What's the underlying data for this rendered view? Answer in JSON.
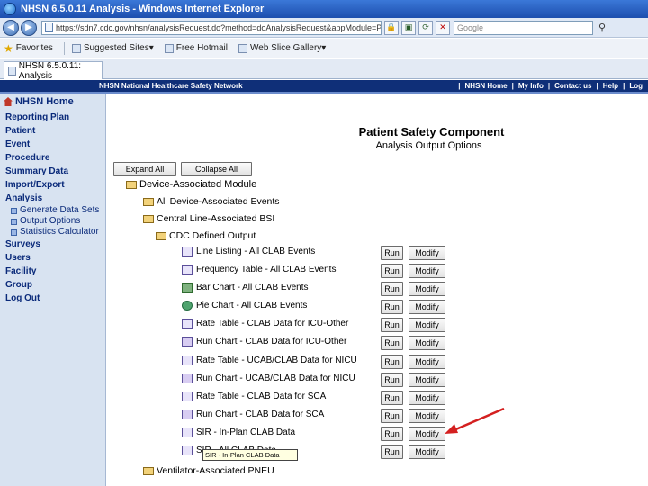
{
  "browser": {
    "window_title": "NHSN 6.5.0.11 Analysis - Windows Internet Explorer",
    "address_url": "https://sdn7.cdc.gov/nhsn/analysisRequest.do?method=doAnalysisRequest&appModule=PS&newF",
    "search_placeholder": "Google",
    "favorites": [
      {
        "label": "Favorites",
        "icon": "favorites-star-icon"
      },
      {
        "label": "Suggested Sites",
        "icon": "page-icon"
      },
      {
        "label": "Free Hotmail",
        "icon": "page-icon"
      },
      {
        "label": "Web Slice Gallery",
        "icon": "page-icon"
      }
    ],
    "tab_label": "NHSN 6.5.0.11: Analysis"
  },
  "nhsn_header": {
    "left": "NHSN   National Healthcare Safety Network",
    "links": [
      "NHSN Home",
      "My Info",
      "Contact us",
      "Help",
      "Log"
    ]
  },
  "sidebar": {
    "home": "NHSN Home",
    "items": [
      {
        "label": "Reporting Plan"
      },
      {
        "label": "Patient"
      },
      {
        "label": "Event"
      },
      {
        "label": "Procedure"
      },
      {
        "label": "Summary Data"
      },
      {
        "label": "Import/Export"
      },
      {
        "label": "Analysis"
      }
    ],
    "subitems": [
      {
        "label": "Generate Data Sets"
      },
      {
        "label": "Output Options"
      },
      {
        "label": "Statistics Calculator"
      }
    ],
    "items_after": [
      {
        "label": "Surveys"
      },
      {
        "label": "Users"
      },
      {
        "label": "Facility"
      },
      {
        "label": "Group"
      },
      {
        "label": "Log Out"
      }
    ]
  },
  "main": {
    "title": "Patient Safety Component",
    "subtitle": "Analysis Output Options",
    "expand_all": "Expand All",
    "collapse_all": "Collapse All",
    "tree": {
      "module": "Device-Associated Module",
      "all_events": "All Device-Associated Events",
      "clabsi": "Central Line-Associated BSI",
      "cdc_output": "CDC Defined Output"
    },
    "run_label": "Run",
    "modify_label": "Modify",
    "outputs": [
      {
        "label": "Line Listing - All CLAB Events"
      },
      {
        "label": "Frequency Table - All CLAB Events"
      },
      {
        "label": "Bar Chart - All CLAB Events"
      },
      {
        "label": "Pie Chart - All CLAB Events"
      },
      {
        "label": "Rate Table - CLAB Data for ICU-Other"
      },
      {
        "label": "Run Chart - CLAB Data for ICU-Other"
      },
      {
        "label": "Rate Table - UCAB/CLAB Data for NICU"
      },
      {
        "label": "Run Chart - UCAB/CLAB Data for NICU"
      },
      {
        "label": "Rate Table - CLAB Data for SCA"
      },
      {
        "label": "Run Chart - CLAB Data for SCA"
      },
      {
        "label": "SIR - In-Plan CLAB Data"
      },
      {
        "label": "SIR - All CLAB Data"
      }
    ],
    "tooltip": "SIR - In-Plan CLAB Data",
    "ventilator": "Ventilator-Associated PNEU"
  }
}
